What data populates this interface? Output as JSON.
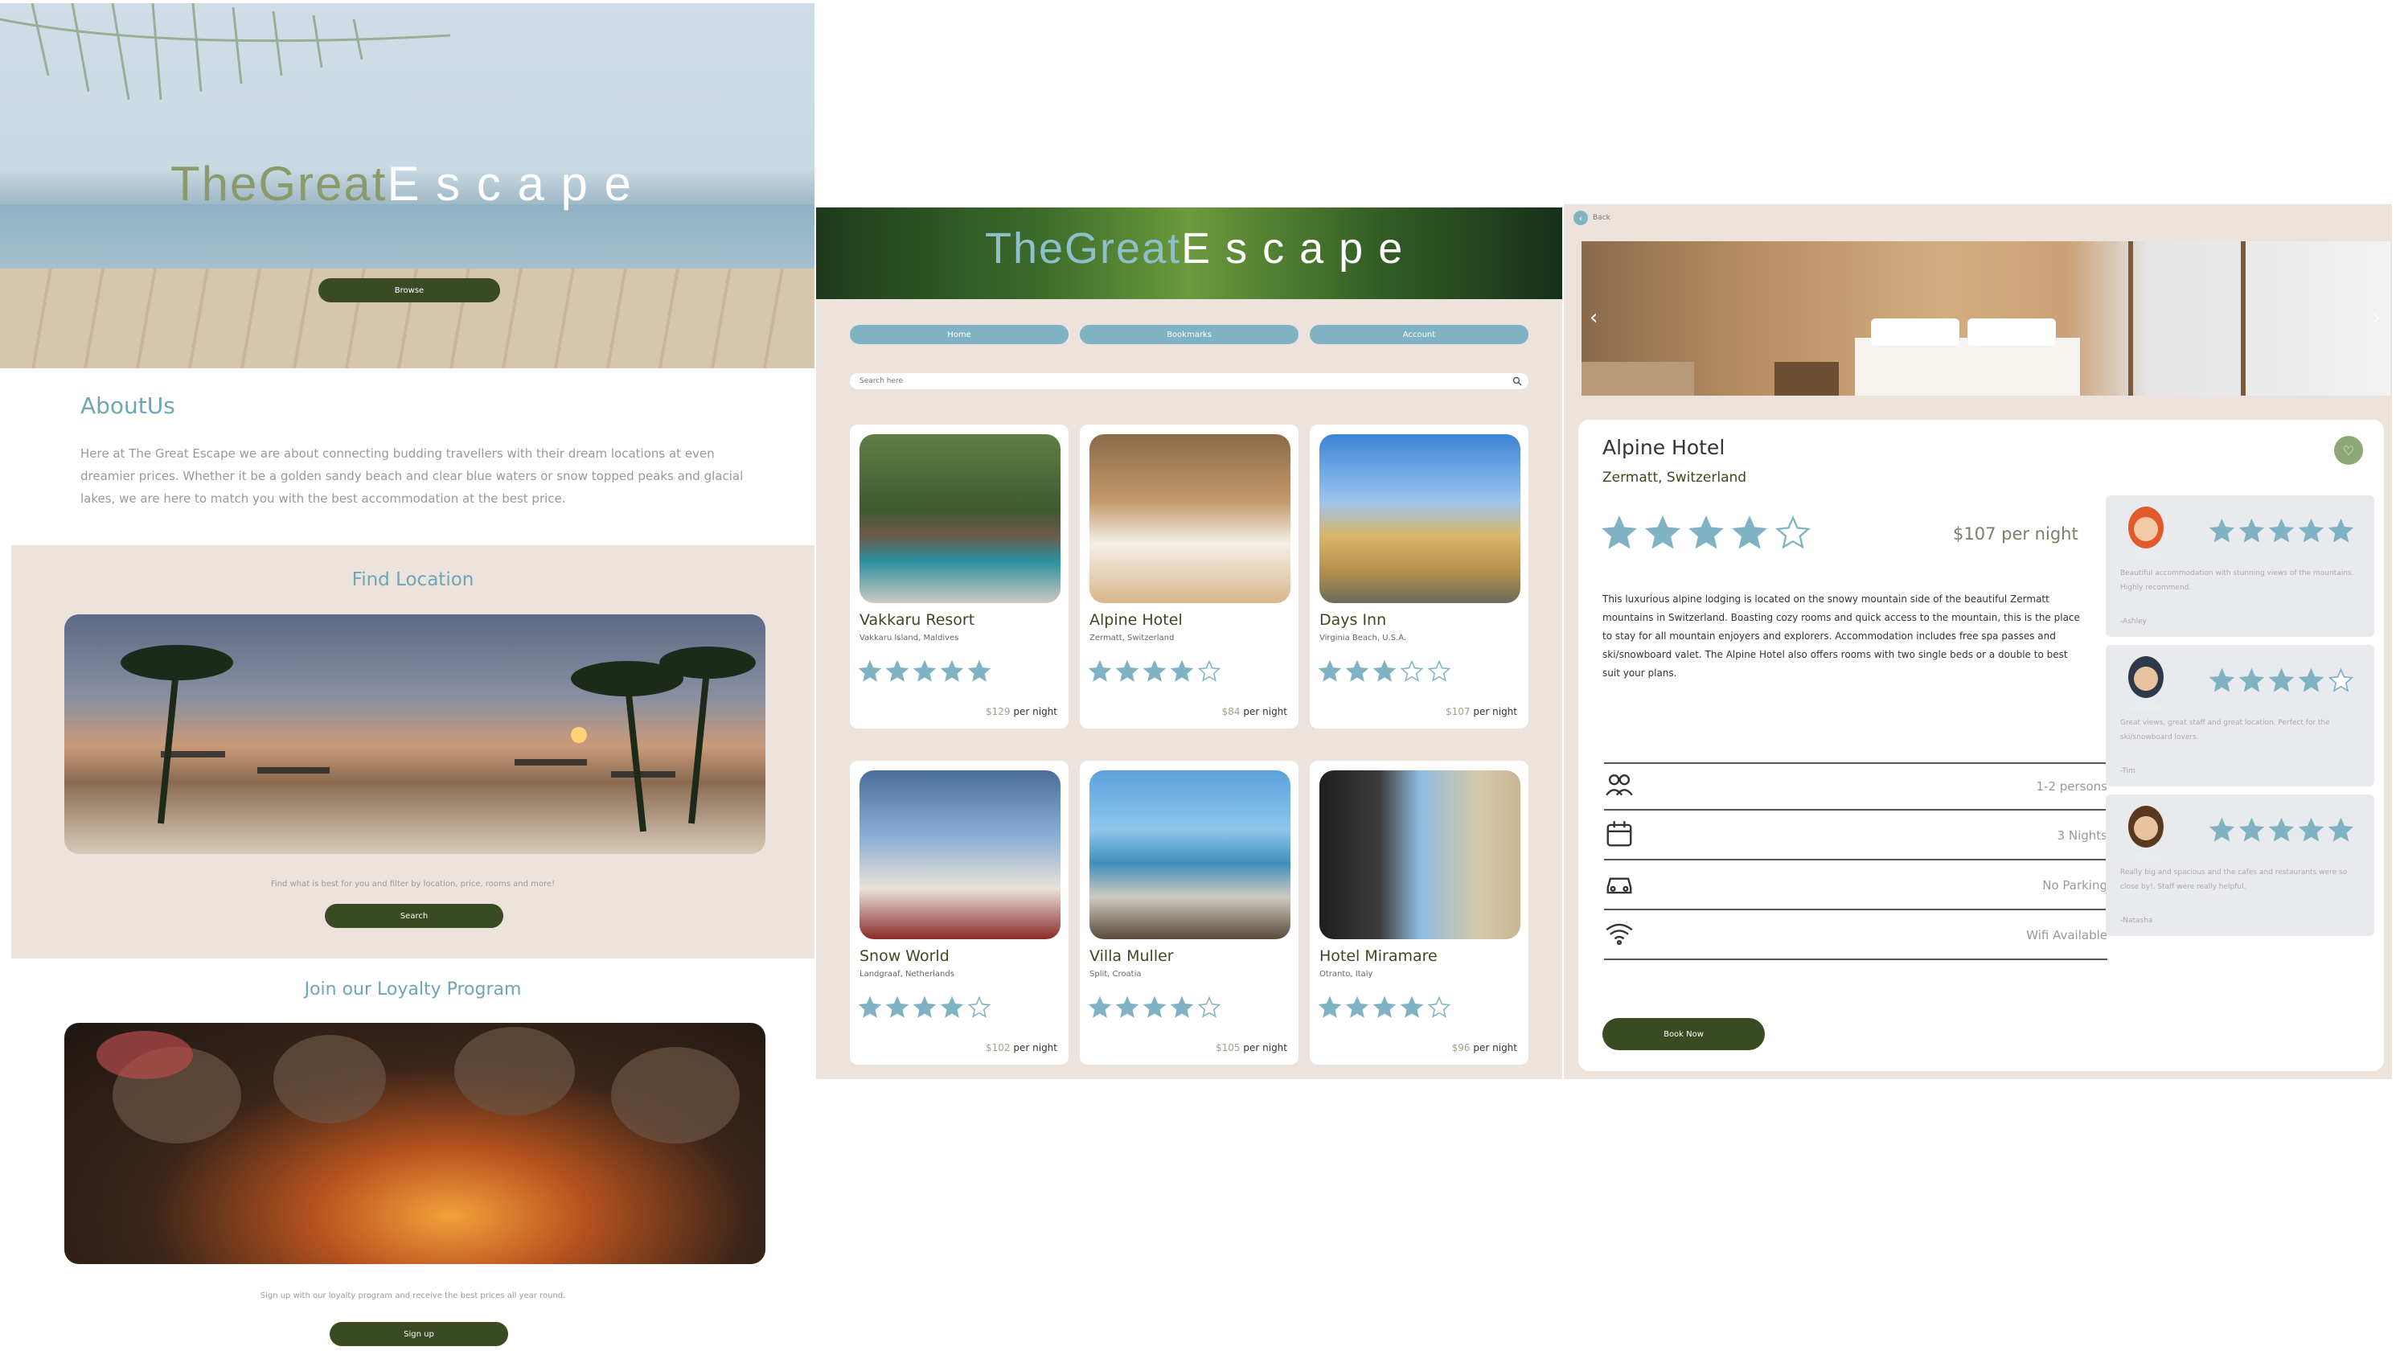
{
  "landing": {
    "logo_part1": "TheGreat",
    "logo_part2": "E s c a p e",
    "browse_label": "Browse",
    "about_title": "AboutUs",
    "about_text": "Here at The Great Escape we are about connecting budding travellers with their dream locations at even dreamier prices. Whether it be a golden sandy beach and clear blue waters or snow topped peaks and glacial lakes, we are here to match you with the best accommodation at the best price.",
    "find_title": "Find Location",
    "find_text": "Find what is best for you and filter by location, price, rooms and more!",
    "search_button": "Search",
    "loyalty_title": "Join our Loyalty Program",
    "loyalty_text": "Sign up with our loyalty program and receive the best prices all year round.",
    "signup_button": "Sign up"
  },
  "browse": {
    "logo_part1": "TheGreat",
    "logo_part2": "E s c a p e",
    "nav": [
      "Home",
      "Bookmarks",
      "Account"
    ],
    "search_placeholder": "Search here",
    "hotels": [
      {
        "name": "Vakkaru Resort",
        "location": "Vakkaru Island, Maldives",
        "price": "$129",
        "per": "per night",
        "rating": 5
      },
      {
        "name": "Alpine Hotel",
        "location": "Zermatt, Switzerland",
        "price": "$84",
        "per": "per night",
        "rating": 4
      },
      {
        "name": "Days Inn",
        "location": "Virginia Beach, U.S.A.",
        "price": "$107",
        "per": "per night",
        "rating": 3
      },
      {
        "name": "Snow World",
        "location": "Landgraaf, Netherlands",
        "price": "$102",
        "per": "per night",
        "rating": 4
      },
      {
        "name": "Villa Muller",
        "location": "Split, Croatia",
        "price": "$105",
        "per": "per night",
        "rating": 4
      },
      {
        "name": "Hotel Miramare",
        "location": "Otranto, Italy",
        "price": "$96",
        "per": "per night",
        "rating": 4
      }
    ]
  },
  "detail": {
    "back_label": "Back",
    "name": "Alpine Hotel",
    "location": "Zermatt, Switzerland",
    "rating": 4,
    "price": "$107 per night",
    "description": "This luxurious alpine lodging is located on the snowy mountain side of the beautiful Zermatt mountains in Switzerland. Boasting cozy rooms and quick access to the mountain, this is the place to stay for all mountain enjoyers and explorers. Accommodation includes free spa passes and ski/snowboard valet. The Alpine Hotel also offers rooms with two single beds or a double to best suit your plans.",
    "features": [
      {
        "icon": "people-icon",
        "label": "1-2 persons"
      },
      {
        "icon": "calendar-icon",
        "label": "3 Nights"
      },
      {
        "icon": "car-icon",
        "label": "No Parking"
      },
      {
        "icon": "wifi-icon",
        "label": "Wifi Available"
      }
    ],
    "book_label": "Book Now",
    "reviews": [
      {
        "rating": 5,
        "text": "Beautiful accommodation with stunning views of the mountains. Highly recommend.",
        "author": "-Ashley"
      },
      {
        "rating": 4,
        "text": "Great views, great staff and great location. Perfect for the ski/snowboard lovers.",
        "author": "-Tim"
      },
      {
        "rating": 5,
        "text": "Really big and spacious and the cafes and restaurants were so close by!. Staff were really helpful.",
        "author": "-Natasha"
      }
    ]
  },
  "colors": {
    "accent": "#7fb2c2",
    "dark_button": "#3a4a22",
    "panel_beige": "#ece3dd",
    "title_teal": "#6ea6b6"
  }
}
